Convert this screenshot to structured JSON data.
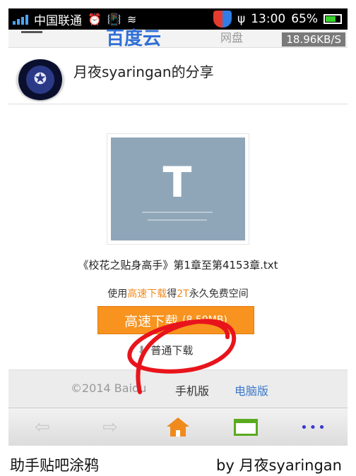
{
  "status_bar": {
    "carrier": "中国联通",
    "time": "13:00",
    "battery": "65%",
    "icons": [
      "signal-icon",
      "alarm-icon",
      "vibrate-icon",
      "wifi-icon",
      "shield-icon",
      "usb-icon",
      "battery-icon"
    ]
  },
  "app_header": {
    "brand": "百度云",
    "brand_sub": "网盘",
    "speed": "18.96KB/S"
  },
  "share": {
    "title": "月夜syaringan的分享",
    "thumb_letter": "T",
    "filename": "《校花之贴身高手》第1章至第4153章.txt",
    "promo_prefix": "使用",
    "promo_highlight1": "高速下载",
    "promo_mid": "得",
    "promo_highlight2": "2T",
    "promo_suffix": "永久免费空间",
    "fast_download_label": "高速下载",
    "fast_download_size": "(8.59MB)",
    "normal_download_label": "普通下载"
  },
  "footer": {
    "copyright": "©2014 Baidu",
    "mobile_label": "手机版",
    "pc_label": "电脑版"
  },
  "navbar": {
    "more_glyph": "•••"
  },
  "caption": {
    "left": "助手贴吧涂鸦",
    "right": "by 月夜syaringan"
  },
  "colors": {
    "accent_orange": "#f7931e",
    "link_blue": "#3a78c9",
    "scribble_red": "#e8141c",
    "thumb_bg": "#8fa6b8"
  }
}
